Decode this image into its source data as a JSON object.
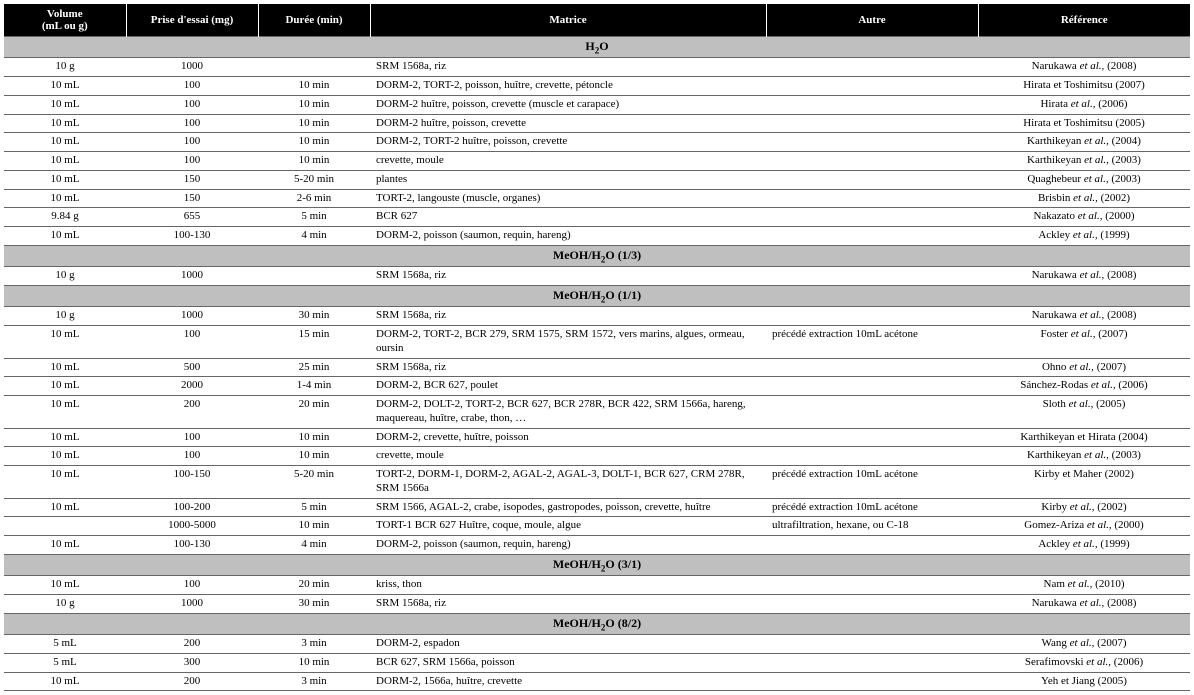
{
  "headers": {
    "volume": "Volume\n(mL ou g)",
    "prise": "Prise d'essai (mg)",
    "duree": "Durée (min)",
    "matrice": "Matrice",
    "autre": "Autre",
    "reference": "Référence"
  },
  "sections": [
    {
      "title_html": "H<sub>2</sub>O",
      "rows": [
        {
          "volume": "10 g",
          "prise": "1000",
          "duree": "",
          "matrice": "SRM 1568a, riz",
          "autre": "",
          "ref_html": "Narukawa <span class='ref-italic'>et al.,</span> (2008)"
        },
        {
          "volume": "10 mL",
          "prise": "100",
          "duree": "10 min",
          "matrice": "DORM-2, TORT-2, poisson, huître, crevette, pétoncle",
          "autre": "",
          "ref_html": "Hirata et Toshimitsu (2007)"
        },
        {
          "volume": "10 mL",
          "prise": "100",
          "duree": "10 min",
          "matrice": "DORM-2 huître, poisson, crevette (muscle et carapace)",
          "autre": "",
          "ref_html": "Hirata <span class='ref-italic'>et al.,</span> (2006)"
        },
        {
          "volume": "10 mL",
          "prise": "100",
          "duree": "10 min",
          "matrice": "DORM-2 huître, poisson, crevette",
          "autre": "",
          "ref_html": "Hirata et Toshimitsu (2005)"
        },
        {
          "volume": "10 mL",
          "prise": "100",
          "duree": "10 min",
          "matrice": "DORM-2, TORT-2 huître, poisson, crevette",
          "autre": "",
          "ref_html": "Karthikeyan <span class='ref-italic'>et al.,</span> (2004)"
        },
        {
          "volume": "10 mL",
          "prise": "100",
          "duree": "10 min",
          "matrice": "crevette, moule",
          "autre": "",
          "ref_html": "Karthikeyan <span class='ref-italic'>et al.,</span> (2003)"
        },
        {
          "volume": "10 mL",
          "prise": "150",
          "duree": "5-20 min",
          "matrice": "plantes",
          "autre": "",
          "ref_html": "Quaghebeur <span class='ref-italic'>et al.,</span> (2003)"
        },
        {
          "volume": "10 mL",
          "prise": "150",
          "duree": "2-6 min",
          "matrice": "TORT-2, langouste (muscle, organes)",
          "autre": "",
          "ref_html": "Brisbin <span class='ref-italic'>et al.,</span> (2002)"
        },
        {
          "volume": "9.84 g",
          "prise": "655",
          "duree": "5 min",
          "matrice": "BCR 627",
          "autre": "",
          "ref_html": "Nakazato <span class='ref-italic'>et al.,</span> (2000)"
        },
        {
          "volume": "10 mL",
          "prise": "100-130",
          "duree": "4 min",
          "matrice": "DORM-2, poisson (saumon, requin, hareng)",
          "autre": "",
          "ref_html": "Ackley <span class='ref-italic'>et al.,</span> (1999)"
        }
      ]
    },
    {
      "title_html": "MeOH/H<sub>2</sub>O (1/3)",
      "rows": [
        {
          "volume": "10 g",
          "prise": "1000",
          "duree": "",
          "matrice": "SRM 1568a, riz",
          "autre": "",
          "ref_html": "Narukawa <span class='ref-italic'>et al.,</span> (2008)"
        }
      ]
    },
    {
      "title_html": "MeOH/H<sub>2</sub>O (1/1)",
      "rows": [
        {
          "volume": "10 g",
          "prise": "1000",
          "duree": "30 min",
          "matrice": "SRM 1568a, riz",
          "autre": "",
          "ref_html": "Narukawa <span class='ref-italic'>et al.,</span> (2008)"
        },
        {
          "volume": "10 mL",
          "prise": "100",
          "duree": "15 min",
          "matrice": "DORM-2, TORT-2, BCR 279, SRM 1575, SRM 1572, vers marins, algues, ormeau, oursin",
          "autre": "précédé extraction 10mL acétone",
          "ref_html": "Foster <span class='ref-italic'>et al.,</span> (2007)"
        },
        {
          "volume": "10 mL",
          "prise": "500",
          "duree": "25 min",
          "matrice": "SRM 1568a, riz",
          "autre": "",
          "ref_html": "Ohno <span class='ref-italic'>et al.,</span> (2007)"
        },
        {
          "volume": "10 mL",
          "prise": "2000",
          "duree": "1-4 min",
          "matrice": "DORM-2, BCR 627, poulet",
          "autre": "",
          "ref_html": "Sánchez-Rodas <span class='ref-italic'>et al.,</span> (2006)"
        },
        {
          "volume": "10 mL",
          "prise": "200",
          "duree": "20 min",
          "matrice": "DORM-2, DOLT-2, TORT-2, BCR 627, BCR 278R, BCR 422, SRM 1566a, hareng, maquereau, huître, crabe, thon, …",
          "autre": "",
          "ref_html": "Sloth <span class='ref-italic'>et al.,</span> (2005)"
        },
        {
          "volume": "10 mL",
          "prise": "100",
          "duree": "10 min",
          "matrice": "DORM-2, crevette, huître, poisson",
          "autre": "",
          "ref_html": "Karthikeyan et Hirata (2004)"
        },
        {
          "volume": "10 mL",
          "prise": "100",
          "duree": "10 min",
          "matrice": "crevette, moule",
          "autre": "",
          "ref_html": "Karthikeyan <span class='ref-italic'>et al.,</span> (2003)"
        },
        {
          "volume": "10 mL",
          "prise": "100-150",
          "duree": "5-20 min",
          "matrice": "TORT-2, DORM-1, DORM-2, AGAL-2, AGAL-3, DOLT-1, BCR 627, CRM 278R, SRM 1566a",
          "autre": "précédé extraction 10mL acétone",
          "ref_html": "Kirby et Maher (2002)"
        },
        {
          "volume": "10 mL",
          "prise": "100-200",
          "duree": "5 min",
          "matrice": "SRM 1566, AGAL-2, crabe, isopodes, gastropodes, poisson, crevette, huître",
          "autre": "précédé extraction 10mL acétone",
          "ref_html": "Kirby <span class='ref-italic'>et al.,</span> (2002)"
        },
        {
          "volume": "",
          "prise": "1000-5000",
          "duree": "10 min",
          "matrice": "TORT-1 BCR 627 Huître, coque, moule, algue",
          "autre": "ultrafiltration, hexane, ou C-18",
          "ref_html": "Gomez-Ariza <span class='ref-italic'>et al.,</span> (2000)"
        },
        {
          "volume": "10 mL",
          "prise": "100-130",
          "duree": "4 min",
          "matrice": "DORM-2, poisson (saumon, requin, hareng)",
          "autre": "",
          "ref_html": "Ackley <span class='ref-italic'>et al.,</span> (1999)"
        }
      ]
    },
    {
      "title_html": "MeOH/H<sub>2</sub>O (3/1)",
      "rows": [
        {
          "volume": "10 mL",
          "prise": "100",
          "duree": "20 min",
          "matrice": "kriss, thon",
          "autre": "",
          "ref_html": "Nam <span class='ref-italic'>et al.,</span> (2010)"
        },
        {
          "volume": "10 g",
          "prise": "1000",
          "duree": "30 min",
          "matrice": "SRM 1568a, riz",
          "autre": "",
          "ref_html": "Narukawa <span class='ref-italic'>et al.,</span> (2008)"
        }
      ]
    },
    {
      "title_html": "MeOH/H<sub>2</sub>O (8/2)",
      "rows": [
        {
          "volume": "5 mL",
          "prise": "200",
          "duree": "3 min",
          "matrice": "DORM-2, espadon",
          "autre": "",
          "ref_html": "Wang <span class='ref-italic'>et al.,</span> (2007)"
        },
        {
          "volume": "5 mL",
          "prise": "300",
          "duree": "10 min",
          "matrice": "BCR 627, SRM 1566a, poisson",
          "autre": "",
          "ref_html": "Serafimovski <span class='ref-italic'>et al.,</span> (2006)"
        },
        {
          "volume": "10 mL",
          "prise": "200",
          "duree": "3 min",
          "matrice": "DORM-2, 1566a, huître, crevette",
          "autre": "",
          "ref_html": "Yeh et Jiang (2005)"
        }
      ]
    }
  ]
}
